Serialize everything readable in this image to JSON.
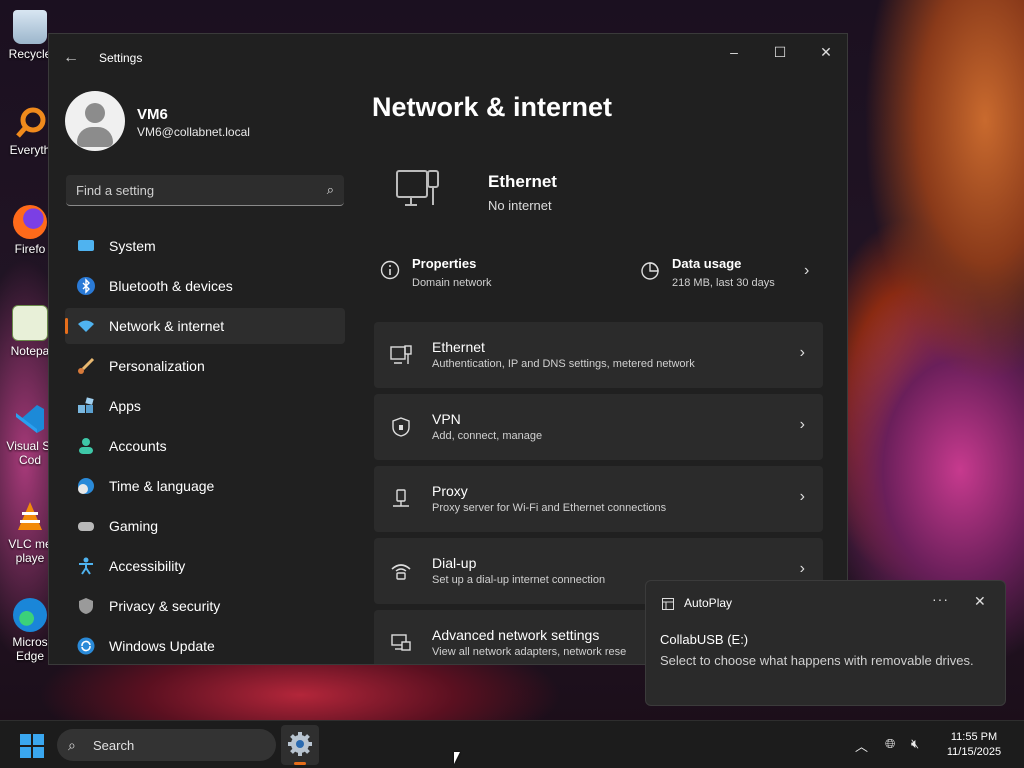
{
  "desktop": {
    "icons": [
      {
        "label": "Recycle",
        "icon": "recycle-bin-icon"
      },
      {
        "label": "Everyth",
        "icon": "everything-search-icon"
      },
      {
        "label": "Firefo",
        "icon": "firefox-icon"
      },
      {
        "label": "Notepa",
        "icon": "notepad-icon"
      },
      {
        "label": "Visual St",
        "label2": "Cod",
        "icon": "vscode-icon"
      },
      {
        "label": "VLC me",
        "label2": "playe",
        "icon": "vlc-icon"
      },
      {
        "label": "Micros",
        "label2": "Edge",
        "icon": "edge-icon"
      }
    ]
  },
  "window": {
    "title": "Settings",
    "controls": {
      "minimize": "–",
      "maximize": "☐",
      "close": "✕"
    }
  },
  "profile": {
    "name": "VM6",
    "email": "VM6@collabnet.local"
  },
  "search": {
    "placeholder": "Find a setting"
  },
  "nav": {
    "items": [
      {
        "label": "System",
        "icon": "system-icon",
        "active": false
      },
      {
        "label": "Bluetooth & devices",
        "icon": "bluetooth-icon",
        "active": false
      },
      {
        "label": "Network & internet",
        "icon": "wifi-icon",
        "active": true
      },
      {
        "label": "Personalization",
        "icon": "brush-icon",
        "active": false
      },
      {
        "label": "Apps",
        "icon": "apps-icon",
        "active": false
      },
      {
        "label": "Accounts",
        "icon": "accounts-icon",
        "active": false
      },
      {
        "label": "Time & language",
        "icon": "globe-clock-icon",
        "active": false
      },
      {
        "label": "Gaming",
        "icon": "gamepad-icon",
        "active": false
      },
      {
        "label": "Accessibility",
        "icon": "accessibility-icon",
        "active": false
      },
      {
        "label": "Privacy & security",
        "icon": "shield-icon",
        "active": false
      },
      {
        "label": "Windows Update",
        "icon": "update-icon",
        "active": false
      }
    ]
  },
  "main": {
    "title": "Network & internet",
    "hero": {
      "name": "Ethernet",
      "status": "No internet"
    },
    "properties": {
      "title": "Properties",
      "subtitle": "Domain network"
    },
    "data_usage": {
      "title": "Data usage",
      "subtitle": "218 MB, last 30 days"
    },
    "cards": [
      {
        "title": "Ethernet",
        "subtitle": "Authentication, IP and DNS settings, metered network",
        "icon": "ethernet-icon"
      },
      {
        "title": "VPN",
        "subtitle": "Add, connect, manage",
        "icon": "vpn-shield-icon"
      },
      {
        "title": "Proxy",
        "subtitle": "Proxy server for Wi-Fi and Ethernet connections",
        "icon": "proxy-icon"
      },
      {
        "title": "Dial-up",
        "subtitle": "Set up a dial-up internet connection",
        "icon": "dialup-icon"
      },
      {
        "title": "Advanced network settings",
        "subtitle": "View all network adapters, network rese",
        "icon": "network-adapter-icon"
      }
    ]
  },
  "notification": {
    "app": "AutoPlay",
    "title": "CollabUSB (E:)",
    "body": "Select to choose what happens with removable drives.",
    "more": "···",
    "close": "✕"
  },
  "taskbar": {
    "search_label": "Search",
    "time": "11:55 PM",
    "date": "11/15/2025"
  },
  "colors": {
    "accent": "#e66e1b",
    "window_bg": "#202020",
    "card_bg": "#2b2b2b"
  }
}
